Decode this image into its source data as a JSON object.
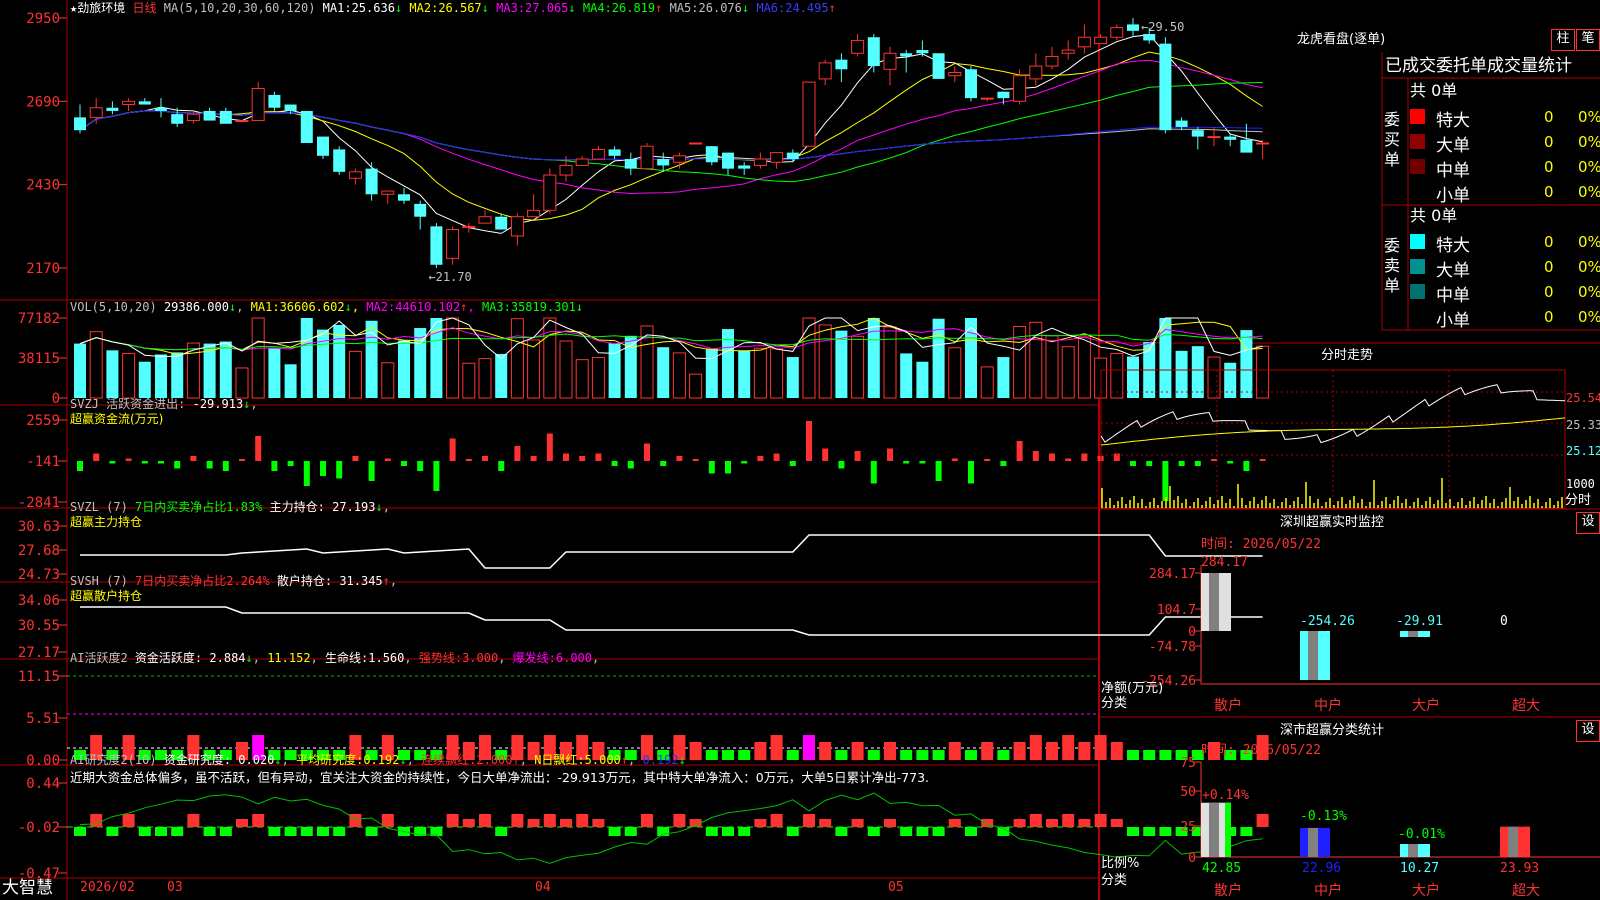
{
  "colors": {
    "up": "#ff3232",
    "down": "#54ffff",
    "grid": "#b00000",
    "ma": [
      "#ffffff",
      "#ffff00",
      "#ff00ff",
      "#00ff00",
      "#c0c0c0",
      "#2020ff"
    ]
  },
  "main": {
    "stock_name": "★劲旅环境",
    "period": "日线",
    "ma_params": "MA(5,10,20,30,60,120)",
    "ma_readouts": [
      {
        "label": "MA1:",
        "value": "25.636",
        "arrow": "↓"
      },
      {
        "label": "MA2:",
        "value": "26.567",
        "arrow": "↓"
      },
      {
        "label": "MA3:",
        "value": "27.065",
        "arrow": "↓"
      },
      {
        "label": "MA4:",
        "value": "26.819",
        "arrow": "↑"
      },
      {
        "label": "MA5:",
        "value": "26.076",
        "arrow": "↓"
      },
      {
        "label": "MA6:",
        "value": "24.495",
        "arrow": "↑"
      }
    ],
    "high_marker": "29.50",
    "low_marker": "21.70",
    "y_ticks": [
      "2950",
      "2690",
      "2430",
      "2170"
    ],
    "y_range": [
      21.7,
      29.5
    ]
  },
  "candles": [
    {
      "o": 26.4,
      "h": 26.8,
      "l": 25.9,
      "c": 26.0
    },
    {
      "o": 26.4,
      "h": 27.0,
      "l": 26.2,
      "c": 26.7
    },
    {
      "o": 26.7,
      "h": 26.9,
      "l": 26.5,
      "c": 26.6
    },
    {
      "o": 26.8,
      "h": 27.0,
      "l": 26.6,
      "c": 26.9
    },
    {
      "o": 26.9,
      "h": 27.0,
      "l": 26.8,
      "c": 26.8
    },
    {
      "o": 26.7,
      "h": 27.0,
      "l": 26.4,
      "c": 26.6
    },
    {
      "o": 26.5,
      "h": 26.7,
      "l": 26.1,
      "c": 26.2
    },
    {
      "o": 26.3,
      "h": 26.6,
      "l": 26.2,
      "c": 26.5
    },
    {
      "o": 26.6,
      "h": 26.7,
      "l": 26.3,
      "c": 26.3
    },
    {
      "o": 26.6,
      "h": 26.7,
      "l": 26.2,
      "c": 26.2
    },
    {
      "o": 26.3,
      "h": 26.3,
      "l": 26.3,
      "c": 26.3
    },
    {
      "o": 26.3,
      "h": 27.5,
      "l": 26.3,
      "c": 27.3
    },
    {
      "o": 27.1,
      "h": 27.2,
      "l": 26.6,
      "c": 26.7
    },
    {
      "o": 26.8,
      "h": 26.8,
      "l": 26.5,
      "c": 26.6
    },
    {
      "o": 26.6,
      "h": 26.6,
      "l": 25.6,
      "c": 25.6
    },
    {
      "o": 25.8,
      "h": 25.8,
      "l": 25.1,
      "c": 25.2
    },
    {
      "o": 25.4,
      "h": 25.5,
      "l": 24.6,
      "c": 24.7
    },
    {
      "o": 24.5,
      "h": 24.8,
      "l": 24.3,
      "c": 24.7
    },
    {
      "o": 24.8,
      "h": 25.0,
      "l": 23.8,
      "c": 24.0
    },
    {
      "o": 24.0,
      "h": 24.1,
      "l": 23.7,
      "c": 24.1
    },
    {
      "o": 24.0,
      "h": 24.2,
      "l": 23.7,
      "c": 23.8
    },
    {
      "o": 23.7,
      "h": 23.8,
      "l": 22.9,
      "c": 23.3
    },
    {
      "o": 23.0,
      "h": 23.1,
      "l": 21.7,
      "c": 21.8
    },
    {
      "o": 22.0,
      "h": 23.0,
      "l": 21.8,
      "c": 22.9
    },
    {
      "o": 23.0,
      "h": 23.1,
      "l": 22.8,
      "c": 23.0
    },
    {
      "o": 23.1,
      "h": 23.5,
      "l": 23.1,
      "c": 23.3
    },
    {
      "o": 23.3,
      "h": 23.4,
      "l": 22.9,
      "c": 22.9
    },
    {
      "o": 22.7,
      "h": 23.4,
      "l": 22.4,
      "c": 23.3
    },
    {
      "o": 23.3,
      "h": 24.0,
      "l": 23.3,
      "c": 23.5
    },
    {
      "o": 23.5,
      "h": 24.8,
      "l": 23.4,
      "c": 24.6
    },
    {
      "o": 24.6,
      "h": 25.2,
      "l": 24.4,
      "c": 24.9
    },
    {
      "o": 24.9,
      "h": 25.2,
      "l": 24.9,
      "c": 25.1
    },
    {
      "o": 25.1,
      "h": 25.5,
      "l": 25.1,
      "c": 25.4
    },
    {
      "o": 25.4,
      "h": 25.5,
      "l": 25.1,
      "c": 25.2
    },
    {
      "o": 25.1,
      "h": 25.3,
      "l": 24.6,
      "c": 24.8
    },
    {
      "o": 24.8,
      "h": 25.6,
      "l": 24.8,
      "c": 25.5
    },
    {
      "o": 25.1,
      "h": 25.3,
      "l": 24.7,
      "c": 24.9
    },
    {
      "o": 25.0,
      "h": 25.3,
      "l": 24.8,
      "c": 25.2
    },
    {
      "o": 25.6,
      "h": 25.6,
      "l": 25.6,
      "c": 25.6
    },
    {
      "o": 25.5,
      "h": 25.5,
      "l": 24.9,
      "c": 25.0
    },
    {
      "o": 25.3,
      "h": 25.3,
      "l": 24.6,
      "c": 24.8
    },
    {
      "o": 24.9,
      "h": 25.0,
      "l": 24.6,
      "c": 24.8
    },
    {
      "o": 24.9,
      "h": 25.3,
      "l": 24.8,
      "c": 25.1
    },
    {
      "o": 25.0,
      "h": 25.3,
      "l": 24.8,
      "c": 25.3
    },
    {
      "o": 25.3,
      "h": 25.4,
      "l": 25.0,
      "c": 25.1
    },
    {
      "o": 25.5,
      "h": 27.5,
      "l": 25.5,
      "c": 27.5
    },
    {
      "o": 27.6,
      "h": 28.2,
      "l": 27.4,
      "c": 28.1
    },
    {
      "o": 28.2,
      "h": 28.4,
      "l": 27.5,
      "c": 27.9
    },
    {
      "o": 28.4,
      "h": 29.0,
      "l": 28.3,
      "c": 28.8
    },
    {
      "o": 28.9,
      "h": 29.0,
      "l": 27.8,
      "c": 28.0
    },
    {
      "o": 27.9,
      "h": 28.6,
      "l": 27.4,
      "c": 28.4
    },
    {
      "o": 28.4,
      "h": 28.5,
      "l": 27.8,
      "c": 28.3
    },
    {
      "o": 28.5,
      "h": 28.8,
      "l": 28.3,
      "c": 28.4
    },
    {
      "o": 28.4,
      "h": 28.4,
      "l": 27.6,
      "c": 27.6
    },
    {
      "o": 27.7,
      "h": 28.0,
      "l": 27.5,
      "c": 27.8
    },
    {
      "o": 27.9,
      "h": 28.0,
      "l": 26.9,
      "c": 27.0
    },
    {
      "o": 27.0,
      "h": 27.0,
      "l": 26.9,
      "c": 27.0
    },
    {
      "o": 27.2,
      "h": 27.2,
      "l": 26.8,
      "c": 27.0
    },
    {
      "o": 26.9,
      "h": 27.9,
      "l": 26.8,
      "c": 27.7
    },
    {
      "o": 27.6,
      "h": 28.4,
      "l": 27.4,
      "c": 28.0
    },
    {
      "o": 28.0,
      "h": 28.6,
      "l": 27.9,
      "c": 28.3
    },
    {
      "o": 28.4,
      "h": 28.8,
      "l": 28.2,
      "c": 28.5
    },
    {
      "o": 28.6,
      "h": 29.3,
      "l": 28.4,
      "c": 28.9
    },
    {
      "o": 28.7,
      "h": 29.0,
      "l": 28.7,
      "c": 28.9
    },
    {
      "o": 28.9,
      "h": 29.3,
      "l": 28.8,
      "c": 29.2
    },
    {
      "o": 29.3,
      "h": 29.5,
      "l": 28.9,
      "c": 29.1
    },
    {
      "o": 29.0,
      "h": 29.2,
      "l": 28.7,
      "c": 28.8
    },
    {
      "o": 28.7,
      "h": 28.9,
      "l": 25.9,
      "c": 26.0
    },
    {
      "o": 26.3,
      "h": 26.4,
      "l": 26.0,
      "c": 26.1
    },
    {
      "o": 26.0,
      "h": 26.1,
      "l": 25.4,
      "c": 25.8
    },
    {
      "o": 25.8,
      "h": 26.1,
      "l": 25.5,
      "c": 25.8
    },
    {
      "o": 25.8,
      "h": 25.9,
      "l": 25.5,
      "c": 25.7
    },
    {
      "o": 25.7,
      "h": 26.2,
      "l": 25.5,
      "c": 25.3
    },
    {
      "o": 25.6,
      "h": 25.7,
      "l": 25.1,
      "c": 25.6
    }
  ],
  "vol": {
    "title": "VOL(5,10,20)",
    "value": "29386.000",
    "ma": [
      {
        "label": "MA1:",
        "value": "36606.602",
        "arrow": "↓"
      },
      {
        "label": "MA2:",
        "value": "44610.102",
        "arrow": "↑"
      },
      {
        "label": "MA3:",
        "value": "35819.301",
        "arrow": "↓"
      }
    ],
    "y_ticks": [
      "77182",
      "38115",
      "0"
    ]
  },
  "svzj": {
    "title": "SVZJ",
    "label": "活跃资金进出:",
    "value": "-29.913",
    "arrow": "↓",
    "subtitle": "超赢资金流(万元)",
    "y_ticks": [
      "2559",
      "-141",
      "-2841"
    ]
  },
  "svzl": {
    "title": "SVZL (7)",
    "label1": "7日内买卖净占比1.83%",
    "label2": "主力持仓:",
    "value": "27.193",
    "arrow": "↓",
    "subtitle": "超赢主力持仓",
    "y_ticks": [
      "30.63",
      "27.68",
      "24.73"
    ]
  },
  "svsh": {
    "title": "SVSH (7)",
    "label1": "7日内买卖净占比2.264%",
    "label2": "散户持仓:",
    "value": "31.345",
    "arrow": "↑",
    "subtitle": "超赢散户持仓",
    "y_ticks": [
      "34.06",
      "30.55",
      "27.17"
    ]
  },
  "ai1": {
    "title": "AI活跃度2",
    "label1": "资金活跃度:",
    "v1": "2.884",
    "a1": "↓",
    "v2": "11.152",
    "label3": "生命线:",
    "v3": "1.560",
    "label4": "强势线:",
    "v4": "3.000",
    "label5": "爆发线:",
    "v5": "6.000",
    "y_ticks": [
      "11.15",
      "5.51",
      "0.00"
    ]
  },
  "ai2": {
    "title": "AI研究度2(10)",
    "label1": "资金研究度:",
    "v1": "0.020",
    "a1": "↓",
    "label2": "平均研究度:",
    "v2": "0.192",
    "a2": "↓",
    "label3": "连续飘红:",
    "v3": "2.000",
    "a3": "↑",
    "label4": "N日飘红:",
    "v4": "5.000",
    "a4": "↑",
    "v5": "0.192",
    "a5": "↓",
    "comment": "近期大资金总体偏多，虽不活跃，但有异动，宜关注大资金的持续性，今日大单净流出：-29.913万元，其中特大单净流入：0万元，大单5日累计净出-773.",
    "y_ticks": [
      "0.44",
      "-0.02",
      "-0.47"
    ]
  },
  "axis": {
    "brand": "大智慧",
    "year": "2026/02",
    "months": [
      "03",
      "04",
      "05"
    ]
  },
  "right": {
    "longhu_title": "龙虎看盘(逐单)",
    "btn_bar": "柱",
    "btn_pen": "笔",
    "tabs": "已成交委托单成交量统计",
    "buy_group": "委买单",
    "sell_group": "委卖单",
    "buy_total": "共 0单",
    "sell_total": "共 0单",
    "buy_rows": [
      {
        "label": "特大",
        "count": "0",
        "pct": "0%",
        "color": "#ff0000"
      },
      {
        "label": "大单",
        "count": "0",
        "pct": "0%",
        "color": "#900000"
      },
      {
        "label": "中单",
        "count": "0",
        "pct": "0%",
        "color": "#700000"
      },
      {
        "label": "小单",
        "count": "0",
        "pct": "0%",
        "color": ""
      }
    ],
    "sell_rows": [
      {
        "label": "特大",
        "count": "0",
        "pct": "0%",
        "color": "#00ffff"
      },
      {
        "label": "大单",
        "count": "0",
        "pct": "0%",
        "color": "#009090"
      },
      {
        "label": "中单",
        "count": "0",
        "pct": "0%",
        "color": "#007070"
      },
      {
        "label": "小单",
        "count": "0",
        "pct": "0%",
        "color": ""
      }
    ],
    "intraday_title": "分时走势",
    "intraday_ticks": [
      "25.54",
      "25.33",
      "25.12"
    ],
    "intraday_vol_label": "1000",
    "intraday_x_label": "分时",
    "sz_monitor_title": "深圳超赢实时监控",
    "sz_monitor_btn": "设",
    "monitor_time": "时间: 2026/05/22",
    "monitor_ticks": [
      "284.17",
      "104.7",
      "0",
      "-74.78",
      "-254.26"
    ],
    "monitor_values": [
      "284.17",
      "-254.26",
      "-29.91",
      "0"
    ],
    "monitor_ylabel": "净额(万元)",
    "monitor_xlabel": "分类",
    "categories": [
      "散户",
      "中户",
      "大户",
      "超大"
    ],
    "stat_title": "深市超赢分类统计",
    "stat_btn": "设",
    "stat_time": "时间: 2026/05/22",
    "stat_ticks": [
      "75",
      "50",
      "25",
      "0"
    ],
    "stat_changes": [
      "+0.14%",
      "-0.13%",
      "-0.01%"
    ],
    "stat_values": [
      "42.85",
      "22.96",
      "10.27",
      "23.93"
    ],
    "stat_ylabel": "比例%",
    "stat_xlabel": "分类"
  }
}
